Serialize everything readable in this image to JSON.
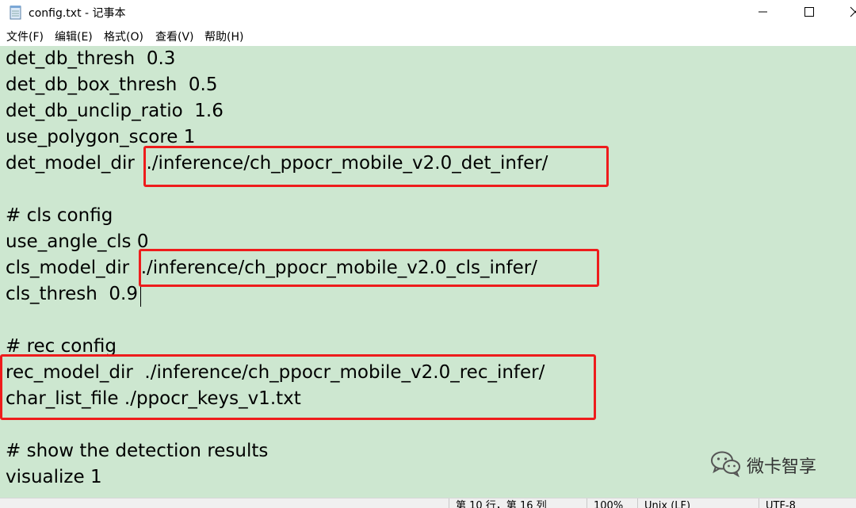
{
  "window": {
    "title": "config.txt - 记事本"
  },
  "menu": [
    "文件(F)",
    "编辑(E)",
    "格式(O)",
    "查看(V)",
    "帮助(H)"
  ],
  "lines": [
    "det_db_thresh  0.3",
    "det_db_box_thresh  0.5",
    "det_db_unclip_ratio  1.6",
    "use_polygon_score 1",
    "det_model_dir  ./inference/ch_ppocr_mobile_v2.0_det_infer/",
    "",
    "# cls config",
    "use_angle_cls 0",
    "cls_model_dir  ./inference/ch_ppocr_mobile_v2.0_cls_infer/",
    "cls_thresh  0.9",
    "",
    "# rec config",
    "rec_model_dir  ./inference/ch_ppocr_mobile_v2.0_rec_infer/",
    "char_list_file ./ppocr_keys_v1.txt",
    "",
    "# show the detection results",
    "visualize 1"
  ],
  "watermark": {
    "text": "微卡智享"
  },
  "status": {
    "position": "第 10 行，第 16 列",
    "zoom": "100%",
    "line_ending": "Unix (LF)",
    "encoding": "UTF-8"
  },
  "colors": {
    "editor_bg": "#cde7d0",
    "highlight": "#ee1c1c"
  }
}
